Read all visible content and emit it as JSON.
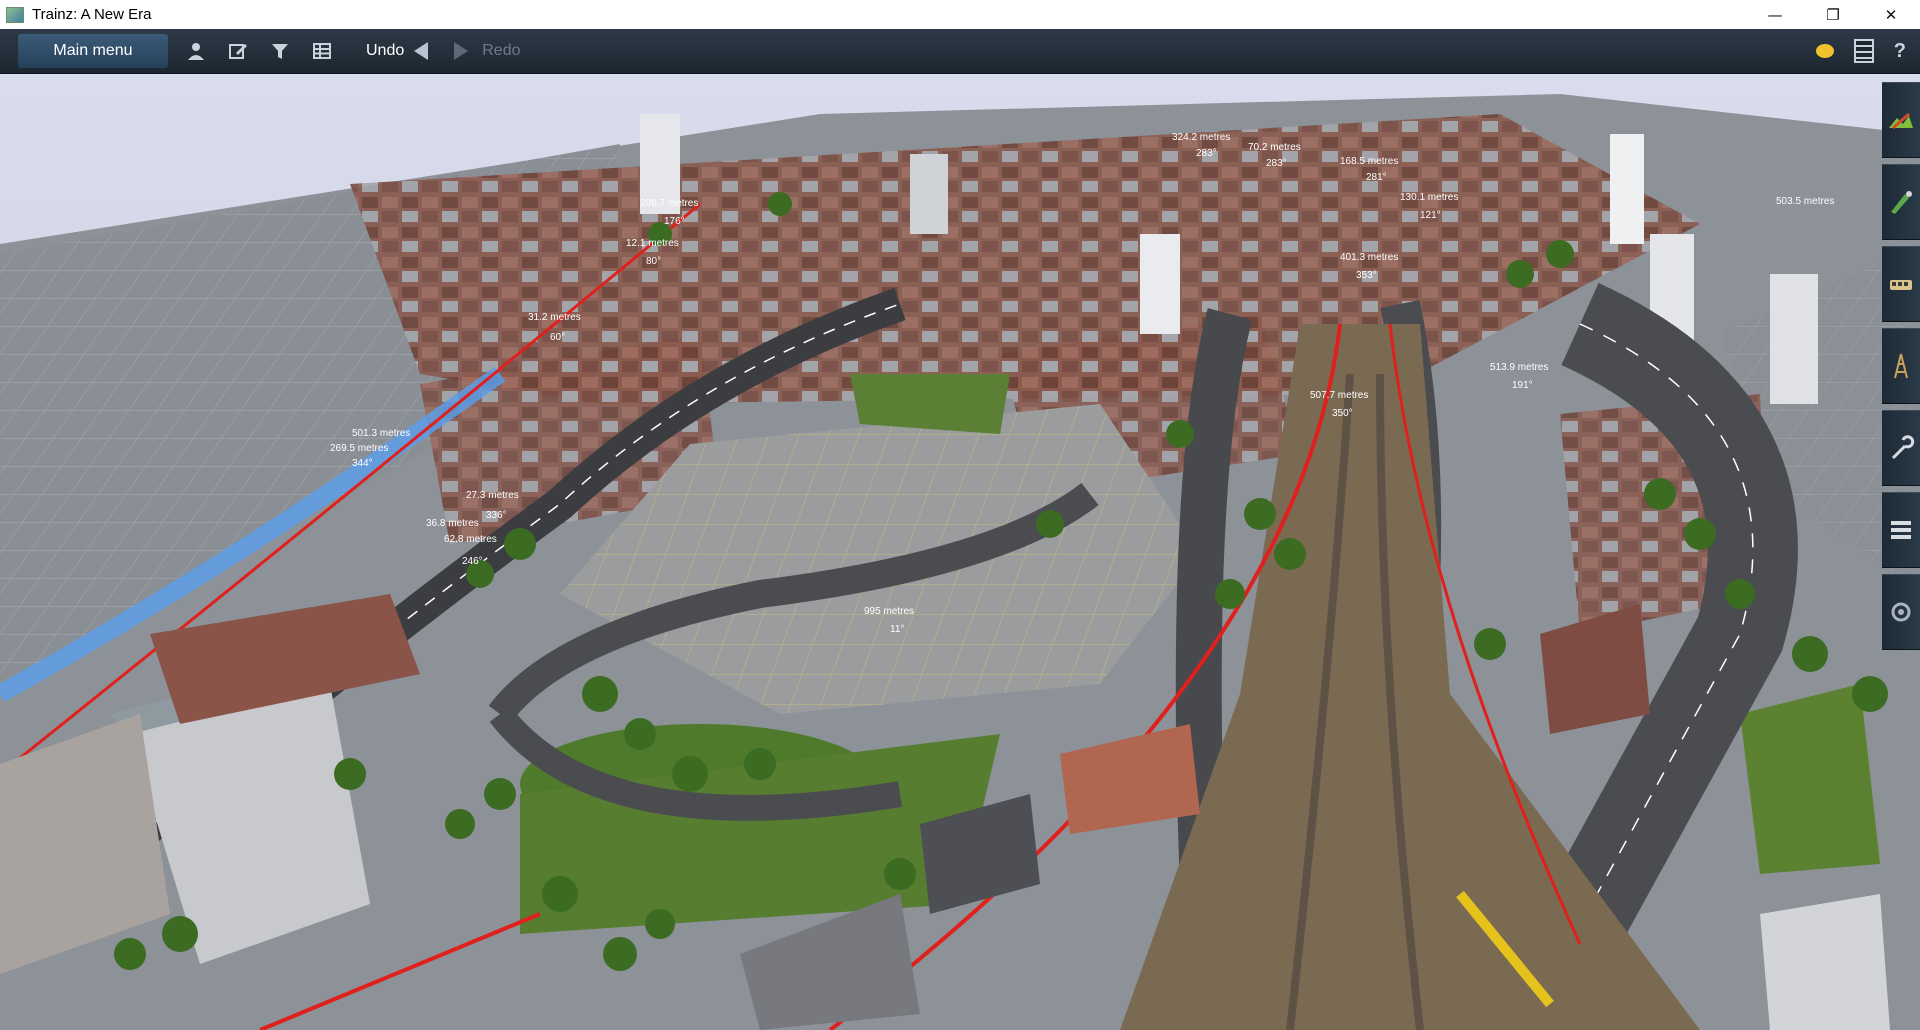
{
  "window": {
    "title": "Trainz: A New Era",
    "controls": {
      "minimize": "—",
      "restore": "❐",
      "close": "✕"
    }
  },
  "toolbar": {
    "main_menu_label": "Main menu",
    "undo_label": "Undo",
    "redo_label": "Redo",
    "icons": [
      "person-icon",
      "edit-icon",
      "filter-icon",
      "grid-table-icon"
    ],
    "help_label": "?"
  },
  "right_palette": {
    "tools": [
      "terrain-tool-icon",
      "paint-tool-icon",
      "objects-tool-icon",
      "track-tool-icon",
      "wrench-tool-icon",
      "layers-tool-icon",
      "settings-tool-icon"
    ]
  },
  "measurements": [
    "501.3 metres",
    "269.5 metres",
    "344°",
    "27.3 metres",
    "36.8 metres",
    "336°",
    "62.8 metres",
    "246°",
    "31.2 metres",
    "60°",
    "12.1 metres",
    "80°",
    "206.7 metres",
    "176°",
    "324.2 metres",
    "283°",
    "70.2 metres",
    "283°",
    "168.5 metres",
    "281°",
    "130.1 metres",
    "121°",
    "401.3 metres",
    "353°",
    "507.7 metres",
    "350°",
    "513.9 metres",
    "191°",
    "995 metres",
    "11°",
    "503.5 metres"
  ],
  "colors": {
    "titlebar_bg": "#ffffff",
    "toolbar_bg": "#1c2630",
    "main_menu_bg": "#2f4d6a",
    "track_red": "#e0201c",
    "grass": "#4f7a2c",
    "sky": "#d4d8e6"
  }
}
